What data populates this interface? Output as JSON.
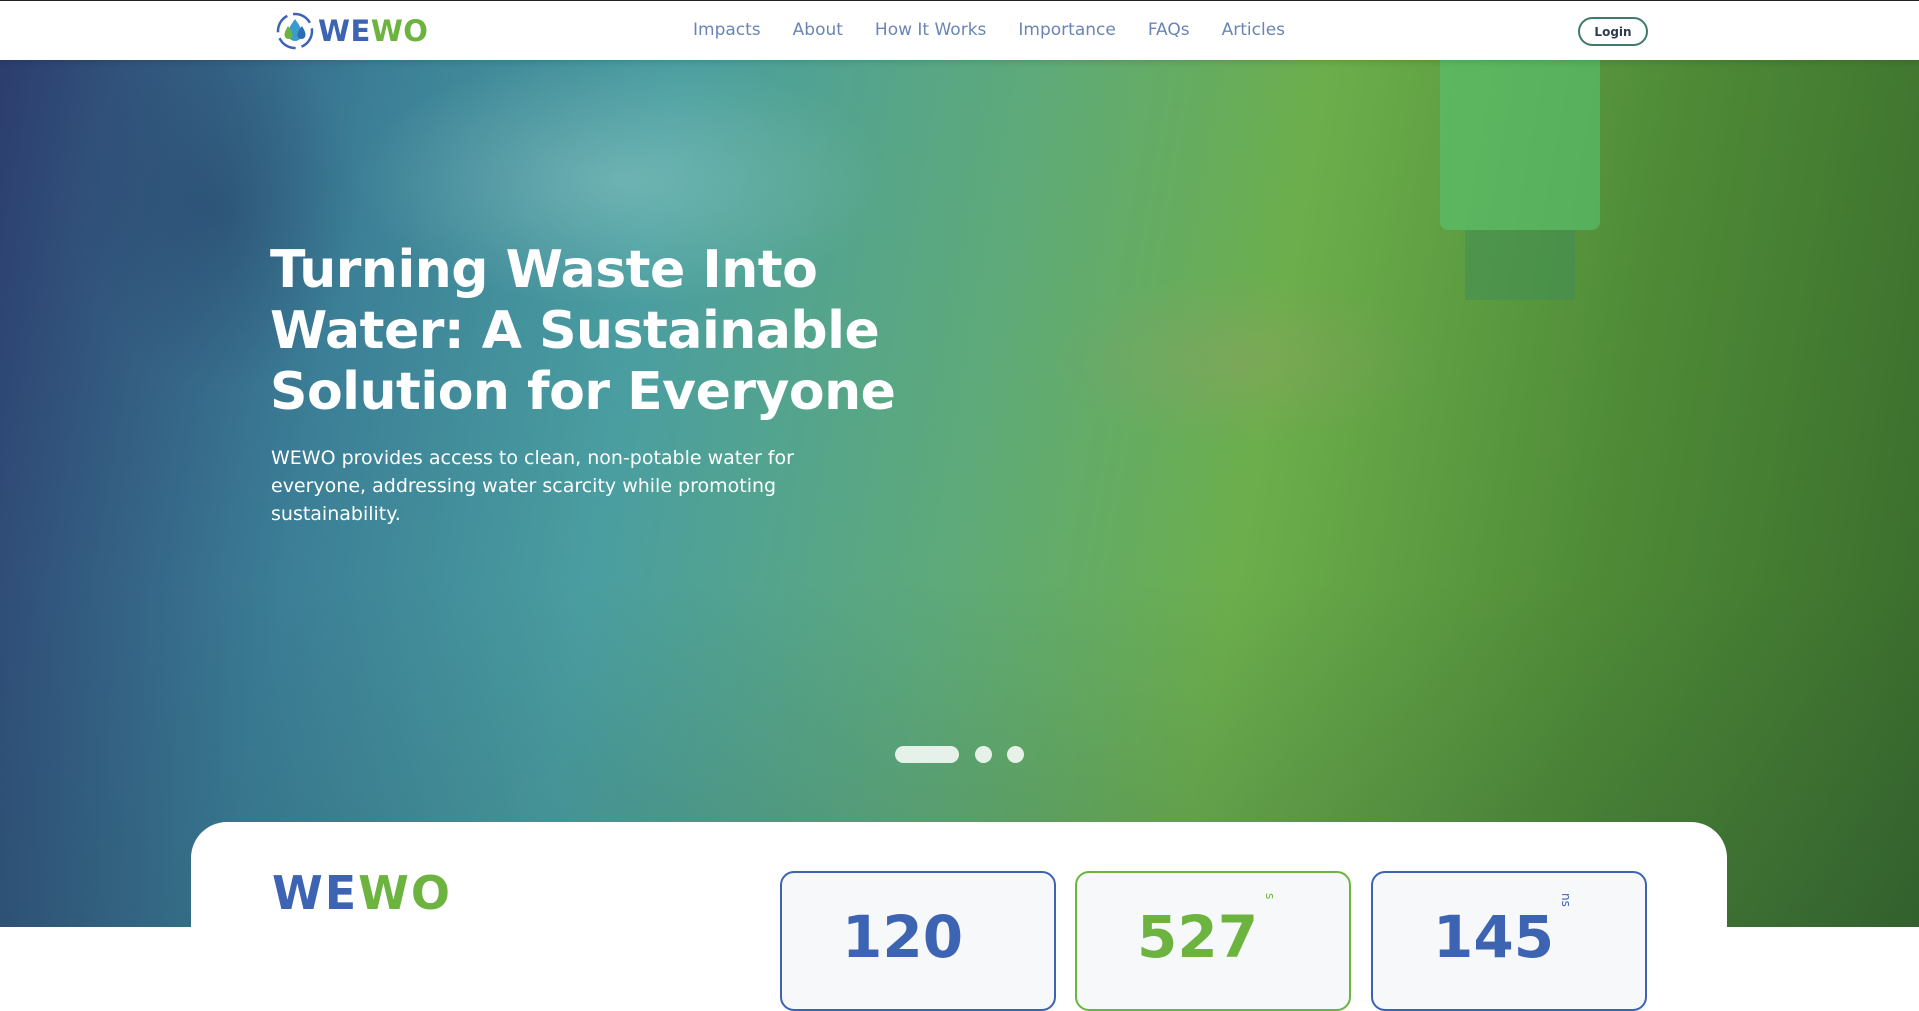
{
  "brand": {
    "logo_prefix": "WE",
    "logo_suffix": "WO",
    "colors": {
      "blue": "#3d63b3",
      "green": "#6db33f"
    }
  },
  "nav": {
    "items": [
      {
        "label": "Impacts"
      },
      {
        "label": "About"
      },
      {
        "label": "How It Works"
      },
      {
        "label": "Importance"
      },
      {
        "label": "FAQs"
      },
      {
        "label": "Articles"
      }
    ],
    "login_label": "Login"
  },
  "hero": {
    "title": "Turning Waste Into Water: A Sustainable Solution for Everyone",
    "subtitle": "WEWO provides access to clean, non-potable water for everyone, addressing water scarcity while promoting sustainability.",
    "carousel": {
      "total_slides": 3,
      "active_slide": 1
    }
  },
  "stats_panel": {
    "logo_prefix": "WE",
    "logo_suffix": "WO",
    "cards": [
      {
        "value": "120",
        "unit": "",
        "accent": "blue"
      },
      {
        "value": "527",
        "unit": "s",
        "accent": "green"
      },
      {
        "value": "145",
        "unit": "ns",
        "accent": "blue"
      }
    ]
  }
}
